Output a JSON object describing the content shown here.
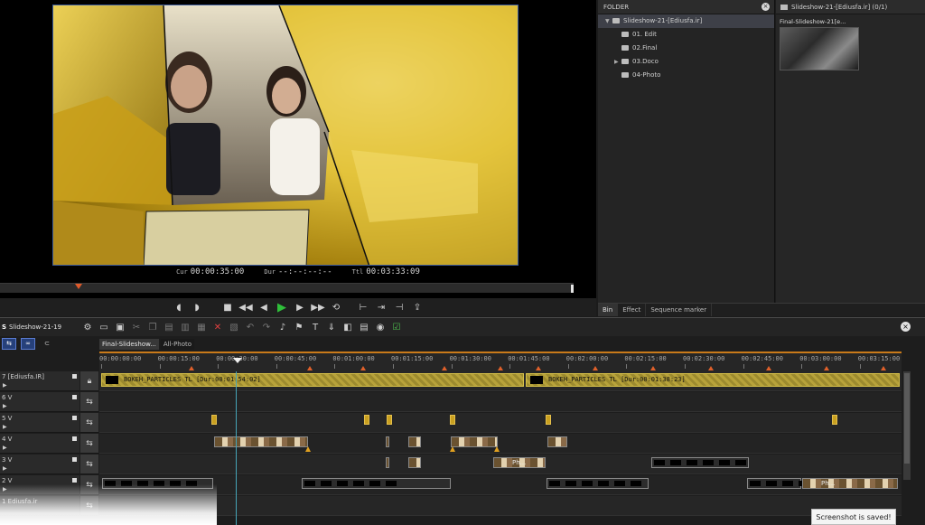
{
  "preview": {
    "cur_label": "Cur",
    "cur_value": "00:00:35:00",
    "dur_label": "Dur",
    "dur_value": "--:--:--:--",
    "ttl_label": "Ttl",
    "ttl_value": "00:03:33:09",
    "frame_palette": {
      "gold": "#e2c13a",
      "shadow": "#5a4406",
      "border": "#3c5a9a"
    }
  },
  "transport": {
    "buttons": [
      "set-in-icon",
      "set-out-icon",
      "stop-icon",
      "rewind-icon",
      "step-back-icon",
      "play-icon",
      "step-forward-icon",
      "fast-forward-icon",
      "loop-icon",
      "insert-icon",
      "overwrite-icon",
      "output-icon",
      "export-icon"
    ]
  },
  "folder": {
    "title": "FOLDER",
    "root": "Slideshow-21-[Ediusfa.ir]",
    "children": [
      "01. Edit",
      "02.Final",
      "03.Doco",
      "04-Photo"
    ]
  },
  "assets": {
    "header": "Slideshow-21-[Ediusfa.ir] (0/1)",
    "item_title": "Final-Slideshow-21[e..."
  },
  "bin_tabs": [
    "Bin",
    "Effect",
    "Sequence marker"
  ],
  "timeline": {
    "project": "Slideshow-21-19",
    "seq_tabs": [
      "Final-Slideshow...",
      "All-Photo"
    ],
    "ruler": [
      "00:00:00:00",
      "00:00:15:00",
      "00:00:30:00",
      "00:00:45:00",
      "00:01:00:00",
      "00:01:15:00",
      "00:01:30:00",
      "00:01:45:00",
      "00:02:00:00",
      "00:02:15:00",
      "00:02:30:00",
      "00:02:45:00",
      "00:03:00:00",
      "00:03:15:00"
    ],
    "tracks": [
      {
        "label": "7 [Ediusfa.IR]"
      },
      {
        "label": "6 V"
      },
      {
        "label": "5 V"
      },
      {
        "label": "4 V"
      },
      {
        "label": "3 V"
      },
      {
        "label": "2 V"
      },
      {
        "label": "1 Ediusfa.ir"
      }
    ],
    "particle_clips": [
      "BOKEH_PARTICLES  TL [Dur:00:01:54:02]",
      "BOKEH_PARTICLES  TL [Dur:00:01:38:23]"
    ],
    "clip_text_short": "Ph...",
    "accent": "#c97a1a",
    "cursor_color": "#46a5b8"
  },
  "toast": "Screenshot is saved!"
}
